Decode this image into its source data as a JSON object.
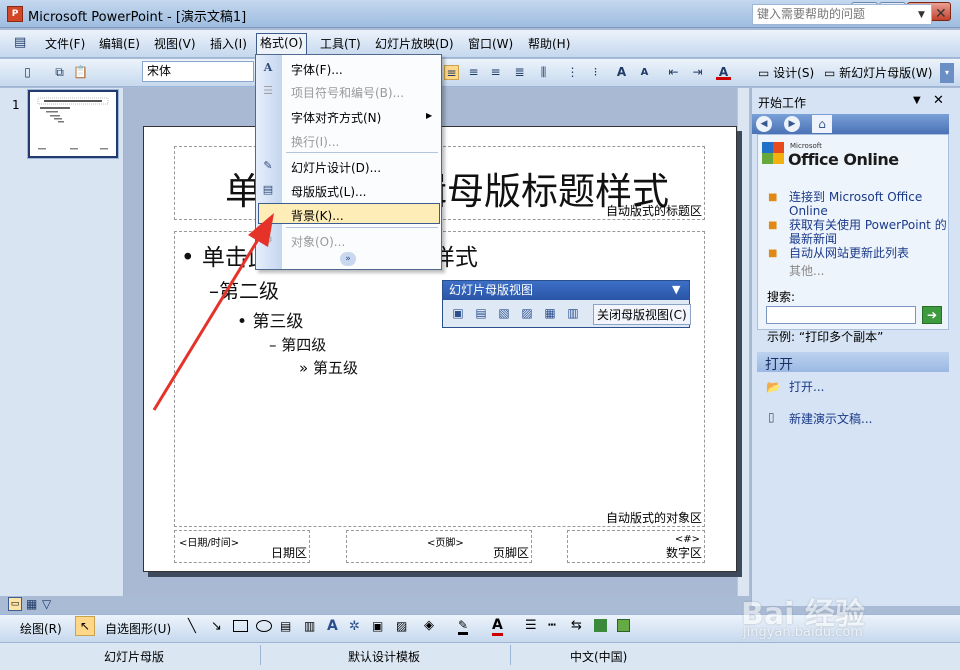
{
  "window": {
    "title": "Microsoft PowerPoint - [演示文稿1]",
    "app_icon": "powerpoint-icon",
    "controls": [
      "minimize-icon",
      "maximize-icon",
      "close-icon"
    ]
  },
  "menubar": {
    "items": [
      {
        "label": "文件(F)"
      },
      {
        "label": "编辑(E)"
      },
      {
        "label": "视图(V)"
      },
      {
        "label": "插入(I)"
      },
      {
        "label": "格式(O)",
        "active": true
      },
      {
        "label": "工具(T)"
      },
      {
        "label": "幻灯片放映(D)"
      },
      {
        "label": "窗口(W)"
      },
      {
        "label": "帮助(H)"
      }
    ],
    "help_placeholder": "键入需要帮助的问题"
  },
  "toolbar": {
    "font_name": "宋体",
    "design_label": "设计(S)",
    "new_master_label": "新幻灯片母版(W)"
  },
  "format_menu": {
    "items": [
      {
        "label": "字体(F)...",
        "enabled": true,
        "icon": "font-a-icon"
      },
      {
        "label": "项目符号和编号(B)...",
        "enabled": false,
        "icon": "bullets-icon"
      },
      {
        "label": "字体对齐方式(N)",
        "enabled": true,
        "submenu": true
      },
      {
        "label": "换行(I)...",
        "enabled": false
      },
      {
        "label": "幻灯片设计(D)...",
        "enabled": true,
        "icon": "slide-design-icon"
      },
      {
        "label": "母版版式(L)...",
        "enabled": true,
        "icon": "master-layout-icon"
      },
      {
        "label": "背景(K)...",
        "enabled": true,
        "highlighted": true
      },
      {
        "label": "对象(O)...",
        "enabled": false,
        "icon": "object-icon"
      }
    ],
    "expand_icon": "double-chevron-down-icon"
  },
  "thumbnail": {
    "number": "1"
  },
  "slide": {
    "title": "单击此处编辑母版标题样式",
    "title_area_label": "自动版式的标题区",
    "body_levels": [
      "单击此处编辑母版文本样式",
      "第二级",
      "第三级",
      "第四级",
      "第五级"
    ],
    "body_bullets": [
      "•",
      "–",
      "•",
      "–",
      "»"
    ],
    "object_area_label": "自动版式的对象区",
    "footer": {
      "date_placeholder": "<日期/时间>",
      "date_label": "日期区",
      "footer_placeholder": "<页脚>",
      "footer_label": "页脚区",
      "number_placeholder": "<#>",
      "number_label": "数字区"
    }
  },
  "master_toolbar": {
    "title": "幻灯片母版视图",
    "close_label": "关闭母版视图(C)"
  },
  "taskpane": {
    "title": "开始工作",
    "logo_small": "Microsoft",
    "logo_text": "Office Online",
    "links": [
      "连接到 Microsoft Office Online",
      "获取有关使用 PowerPoint 的最新新闻",
      "自动从网站更新此列表"
    ],
    "more": "其他...",
    "search_label": "搜索:",
    "example": "示例: “打印多个副本”",
    "open_section": "打开",
    "open_link": "打开...",
    "new_link": "新建演示文稿..."
  },
  "drawbar": {
    "draw_label": "绘图(R)",
    "autoshape_label": "自选图形(U)"
  },
  "statusbar": {
    "view": "幻灯片母版",
    "template": "默认设计模板",
    "language": "中文(中国)"
  },
  "watermark": {
    "brand": "Bai 经验",
    "url": "jingyan.baidu.com"
  },
  "colors": {
    "accent": "#2a55a6",
    "highlight": "#ffedb8",
    "arrow": "#e5332a"
  }
}
